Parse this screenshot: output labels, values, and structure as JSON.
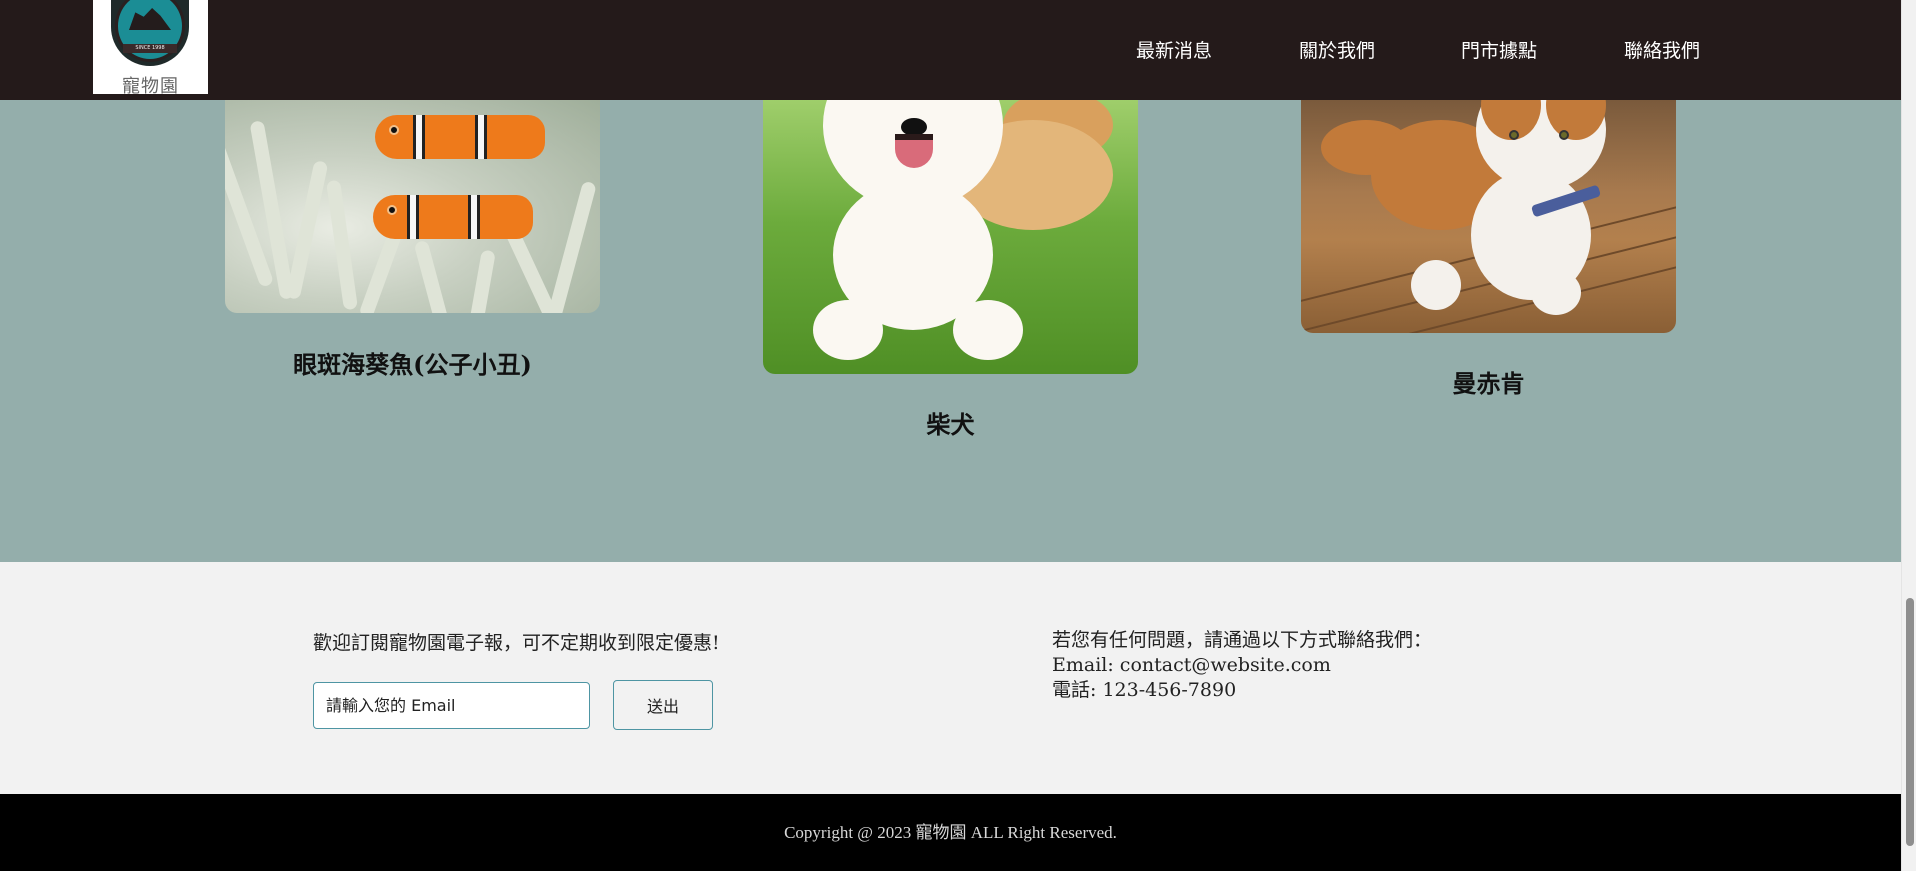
{
  "header": {
    "logo_text": "寵物園",
    "logo_badge": "SINCE 1998",
    "nav": [
      "最新消息",
      "關於我們",
      "門市據點",
      "聯絡我們"
    ]
  },
  "pets": [
    {
      "name": "眼斑海葵魚(公子小丑)"
    },
    {
      "name": "柴犬"
    },
    {
      "name": "曼赤肯"
    }
  ],
  "newsletter": {
    "text": "歡迎訂閱寵物園電子報，可不定期收到限定優惠!",
    "placeholder": "請輸入您的 Email",
    "submit_label": "送出"
  },
  "contact": {
    "heading": "若您有任何問題，請通過以下方式聯絡我們：",
    "email_line": "Email: contact@website.com",
    "phone_line": "電話: 123-456-7890"
  },
  "footer": {
    "copyright": "Copyright @ 2023 寵物園 ALL Right Reserved."
  },
  "colors": {
    "header_bg": "#241a1a",
    "section_bg": "#94aeab",
    "info_bg": "#f2f2f2",
    "copyright_bg": "#000000",
    "accent_border": "#4e95a3"
  }
}
